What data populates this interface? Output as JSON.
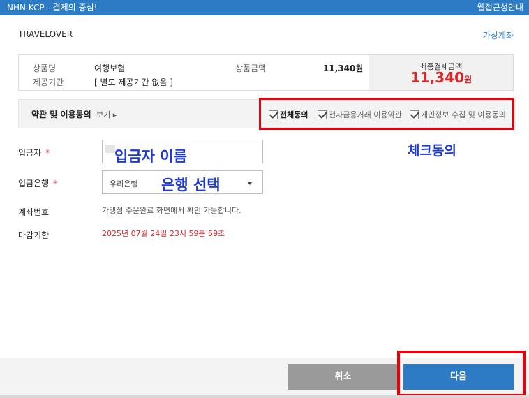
{
  "window": {
    "title": "NHN KCP - 결제의 중심!",
    "accessibility_guide": "웹접근성안내"
  },
  "header": {
    "merchant": "TRAVELOVER",
    "payment_method": "가상계좌"
  },
  "summary": {
    "product_name_label": "상품명",
    "product_name": "여행보험",
    "period_label": "제공기간",
    "period": "[ 별도 제공기간 없음 ]",
    "price_label": "상품금액",
    "price": "11,340원",
    "final_label": "최종결제금액",
    "final_amount": "11,340",
    "final_unit": "원"
  },
  "terms": {
    "title": "약관 및 이용동의",
    "view": "보기 ▸",
    "agree_all": "전체동의",
    "agree_efin": "전자금융거래 이용약관",
    "agree_privacy": "개인정보 수집 및 이용동의"
  },
  "form": {
    "depositor_label": "입금자",
    "bank_label": "입금은행",
    "required_mark": "*",
    "bank_selected": "우리은행",
    "account_label": "계좌번호",
    "account_info": "가맹점 주문완료 화면에서 확인 가능합니다.",
    "deadline_label": "마감기한",
    "deadline": "2025년 07월 24일 23시 59분 59초"
  },
  "annotations": {
    "depositor_name": "입금자 이름",
    "bank_select": "은행 선택",
    "check_agree": "체크동의"
  },
  "buttons": {
    "cancel": "취소",
    "next": "다음"
  },
  "colors": {
    "brand_blue": "#2d7bc4",
    "highlight_red": "#e8000b",
    "amount_red": "#d8282b",
    "annotation_blue": "#1e3ad6"
  }
}
